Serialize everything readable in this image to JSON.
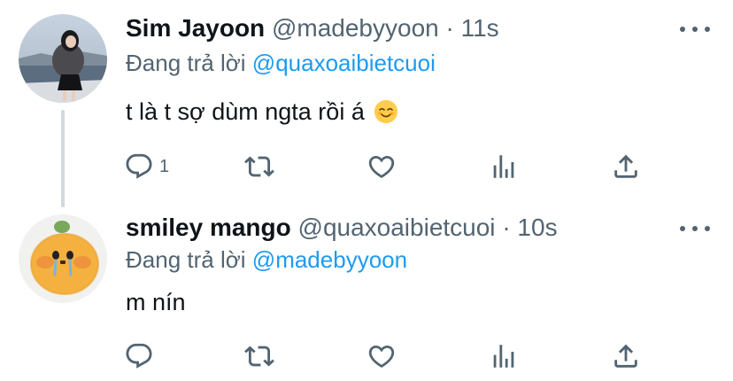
{
  "tweets": [
    {
      "name": "Sim Jayoon",
      "handle": "@madebyyoon",
      "separator": "·",
      "time": "11s",
      "replying_prefix": "Đang trả lời",
      "replying_to": "@quaxoaibietcuoi",
      "text": "t là t sợ dùm ngta rồi á",
      "emoji": "smiling-face-emoji",
      "reply_count": "1",
      "avatar": "photo-avatar"
    },
    {
      "name": "smiley mango",
      "handle": "@quaxoaibietcuoi",
      "separator": "·",
      "time": "10s",
      "replying_prefix": "Đang trả lời",
      "replying_to": "@madebyyoon",
      "text": "m nín",
      "reply_count": "",
      "avatar": "crying-mango-avatar"
    }
  ],
  "colors": {
    "text_primary": "#0f1419",
    "text_secondary": "#536471",
    "link": "#1d9bf0",
    "thread_line": "#cfd9de"
  },
  "action_icons": [
    "reply-icon",
    "retweet-icon",
    "like-icon",
    "analytics-icon",
    "share-icon"
  ]
}
